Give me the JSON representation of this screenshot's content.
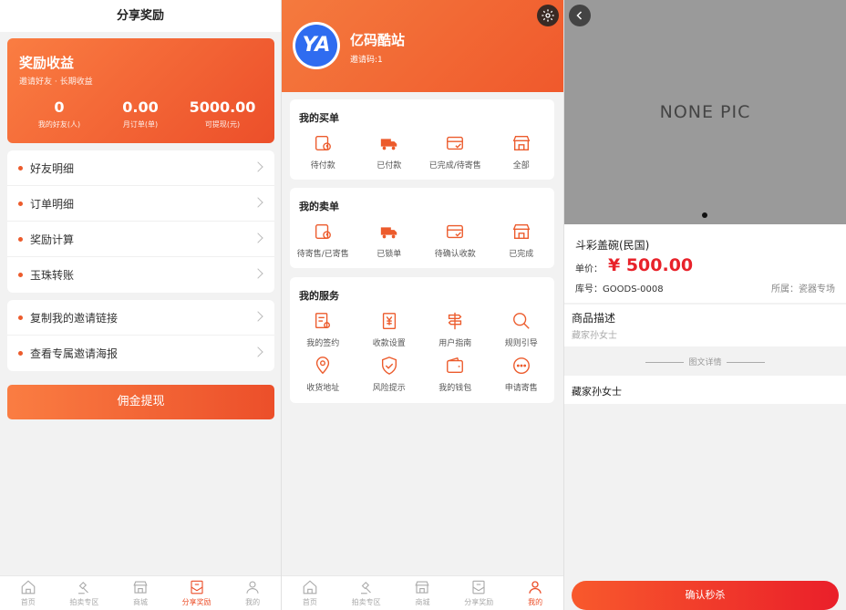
{
  "screen1": {
    "title": "分享奖励",
    "reward": {
      "title": "奖励收益",
      "subtitle": "邀请好友 · 长期收益",
      "stats": [
        {
          "value": "0",
          "label": "我的好友(人)"
        },
        {
          "value": "0.00",
          "label": "月订单(单)"
        },
        {
          "value": "5000.00",
          "label": "可提现(元)"
        }
      ]
    },
    "menu1": [
      "好友明细",
      "订单明细",
      "奖励计算",
      "玉珠转账"
    ],
    "menu2": [
      "复制我的邀请链接",
      "查看专属邀请海报"
    ],
    "withdraw_label": "佣金提现"
  },
  "tabs": [
    "首页",
    "拍卖专区",
    "商城",
    "分享奖励",
    "我的"
  ],
  "screen2": {
    "site_name": "亿码酷站",
    "avatar_text": "YA",
    "invite_code": "邀请码:1",
    "buy": {
      "title": "我的买单",
      "items": [
        "待付款",
        "已付款",
        "已完成/待寄售",
        "全部"
      ]
    },
    "sell": {
      "title": "我的卖单",
      "items": [
        "待寄售/已寄售",
        "已锁单",
        "待确认收款",
        "已完成"
      ]
    },
    "service": {
      "title": "我的服务",
      "items": [
        "我的签约",
        "收款设置",
        "用户指南",
        "规则引导",
        "收货地址",
        "风险提示",
        "我的钱包",
        "申请寄售"
      ]
    }
  },
  "screen3": {
    "no_pic": "NONE PIC",
    "product_title": "斗彩盖碗(民国)",
    "price_label": "单价：",
    "price": "¥ 500.00",
    "sku": "库号：GOODS-0008",
    "category": "所属：瓷器专场",
    "desc_title": "商品描述",
    "desc_text": "藏家孙女士",
    "separator": "图文详情",
    "detail_text": "藏家孙女士",
    "buy_label": "确认秒杀"
  },
  "colors": {
    "accent": "#ec4f2a",
    "price": "#e8222a"
  }
}
